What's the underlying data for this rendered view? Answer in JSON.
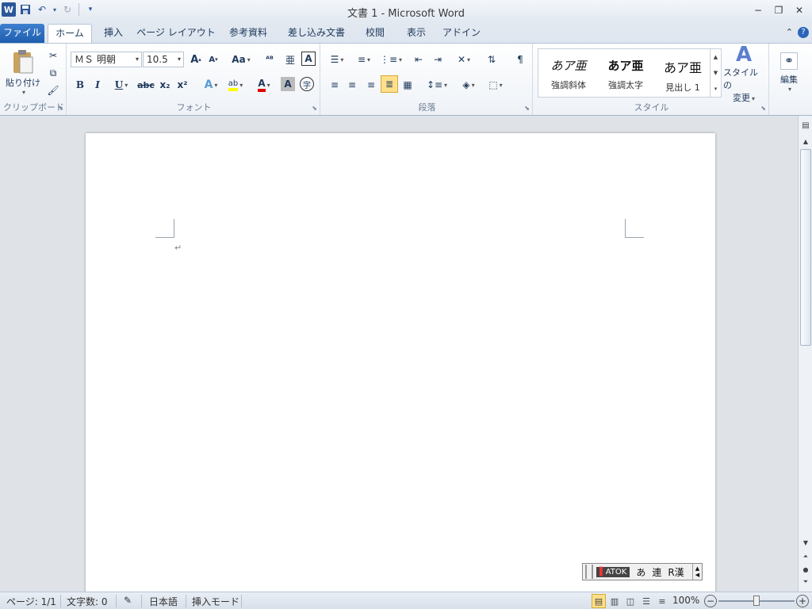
{
  "title_bar": {
    "title": "文書 1 - Microsoft Word",
    "app_icon_letter": "W",
    "min_glyph": "−",
    "restore_glyph": "❐",
    "close_glyph": "✕"
  },
  "tabs": [
    {
      "label": "ファイル",
      "icon": null
    },
    {
      "label": "ホーム"
    },
    {
      "label": "挿入"
    },
    {
      "label": "ページ レイアウト"
    },
    {
      "label": "参考資料"
    },
    {
      "label": "差し込み文書"
    },
    {
      "label": "校閲"
    },
    {
      "label": "表示"
    },
    {
      "label": "アドイン"
    }
  ],
  "ribbon": {
    "clipboard": {
      "paste_label": "貼り付け",
      "group_label": "クリップボード"
    },
    "font": {
      "font_name": "ＭＳ 明朝",
      "font_size": "10.5",
      "bold": "B",
      "italic": "I",
      "underline": "U",
      "strike": "abc",
      "sub": "x₂",
      "sup": "x²",
      "change_case": "Aa",
      "grow": "A",
      "shrink": "A",
      "group_label": "フォント"
    },
    "paragraph": {
      "group_label": "段落"
    },
    "styles": {
      "items": [
        {
          "preview": "あア亜",
          "name": "強調斜体"
        },
        {
          "preview": "あア亜",
          "name": "強調太字"
        },
        {
          "preview": "あア亜",
          "name": "見出し 1"
        }
      ],
      "change_styles_label_1": "スタイルの",
      "change_styles_label_2": "変更",
      "group_label": "スタイル"
    },
    "editing": {
      "label": "編集"
    }
  },
  "document": {
    "paragraph_mark": "↵"
  },
  "ime_bar": {
    "logo": "ATOK",
    "mode1": "あ",
    "mode2": "連",
    "mode3": "R漢"
  },
  "status_bar": {
    "page": "ページ: 1/1",
    "words": "文字数: 0",
    "language": "日本語",
    "insert_mode": "挿入モード",
    "zoom": "100%"
  },
  "colors": {
    "file_tab": "#2b64b8",
    "accent": "#2b579a",
    "highlight": "#ffe08a"
  }
}
